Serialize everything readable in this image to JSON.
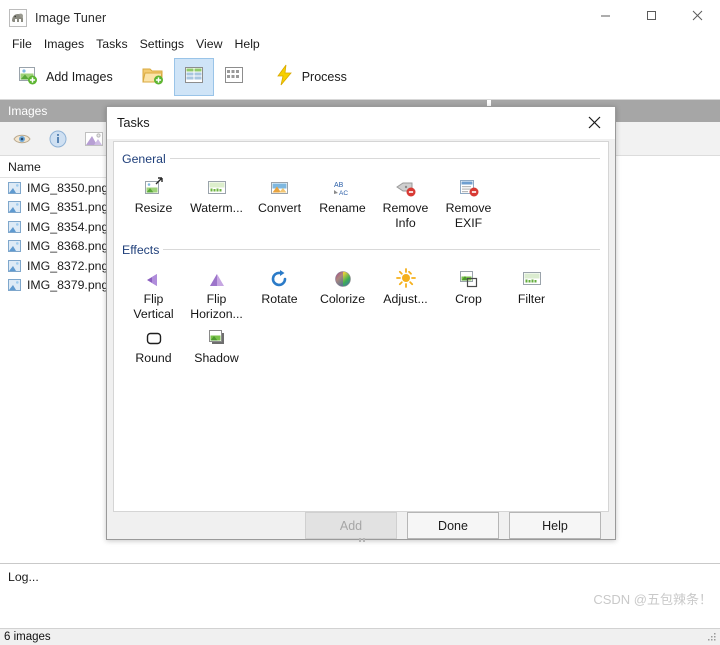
{
  "window": {
    "title": "Image Tuner",
    "app_icon": "elephant-icon",
    "controls": {
      "minimize": "minimize-icon",
      "maximize": "maximize-icon",
      "close": "close-icon"
    }
  },
  "menubar": {
    "items": [
      {
        "label": "File"
      },
      {
        "label": "Images"
      },
      {
        "label": "Tasks"
      },
      {
        "label": "Settings"
      },
      {
        "label": "View"
      },
      {
        "label": "Help"
      }
    ]
  },
  "toolbar": {
    "add_images_label": "Add Images",
    "add_images_icon": "add-images-icon",
    "open_folder_icon": "open-folder-add-icon",
    "details_view_icon": "details-view-icon",
    "thumbnail_view_icon": "thumbnail-view-icon",
    "process_label": "Process",
    "process_icon": "lightning-bolt-icon",
    "selected_view": "details-view-icon"
  },
  "images_panel": {
    "header": "Images",
    "tool_icons": [
      {
        "name": "preview-eye-icon"
      },
      {
        "name": "info-icon"
      },
      {
        "name": "image-mountain-icon"
      }
    ],
    "column_header": "Name",
    "files": [
      {
        "name": "IMG_8350.png"
      },
      {
        "name": "IMG_8351.png"
      },
      {
        "name": "IMG_8354.png"
      },
      {
        "name": "IMG_8368.png"
      },
      {
        "name": "IMG_8372.png"
      },
      {
        "name": "IMG_8379.png"
      }
    ]
  },
  "tasks_panel": {
    "header": "",
    "chip_icon": "red-task-chip"
  },
  "dialog": {
    "title": "Tasks",
    "close_icon": "close-icon",
    "groups": [
      {
        "title": "General",
        "tasks": [
          {
            "label": "Resize",
            "icon": "resize-icon"
          },
          {
            "label": "Waterm...",
            "icon": "watermark-icon"
          },
          {
            "label": "Convert",
            "icon": "convert-icon"
          },
          {
            "label": "Rename",
            "icon": "rename-icon"
          },
          {
            "label": "Remove Info",
            "icon": "remove-info-icon"
          },
          {
            "label": "Remove EXIF",
            "icon": "remove-exif-icon"
          }
        ]
      },
      {
        "title": "Effects",
        "tasks": [
          {
            "label": "Flip Vertical",
            "icon": "flip-vertical-icon"
          },
          {
            "label": "Flip Horizon...",
            "icon": "flip-horizontal-icon"
          },
          {
            "label": "Rotate",
            "icon": "rotate-icon"
          },
          {
            "label": "Colorize",
            "icon": "colorize-icon"
          },
          {
            "label": "Adjust...",
            "icon": "adjust-brightness-icon"
          },
          {
            "label": "Crop",
            "icon": "crop-icon"
          },
          {
            "label": "Filter",
            "icon": "filter-icon"
          },
          {
            "label": "Round",
            "icon": "round-corners-icon"
          },
          {
            "label": "Shadow",
            "icon": "shadow-icon"
          }
        ]
      }
    ],
    "buttons": {
      "add": "Add",
      "add_enabled": false,
      "done": "Done",
      "help": "Help"
    }
  },
  "log": {
    "text": "Log...",
    "watermark": "CSDN @五包辣条！"
  },
  "statusbar": {
    "text": "6 images"
  },
  "colors": {
    "accent_selected": "#cfe4f7",
    "panel_header": "#a6a6a6",
    "group_title": "#1f3f7a",
    "chip": "#e8a79e"
  }
}
